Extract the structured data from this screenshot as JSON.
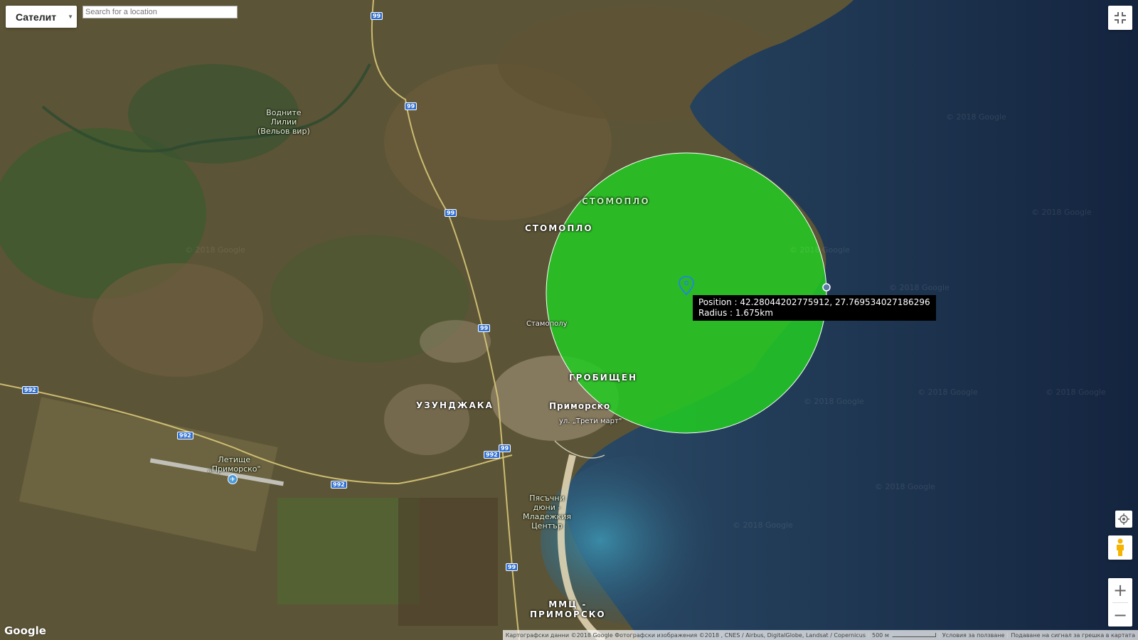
{
  "map_type": {
    "label": "Сателит"
  },
  "search": {
    "placeholder": "Search for a location",
    "value": ""
  },
  "tooltip": {
    "position_line": "Position : 42.28044202775912, 27.769534027186296",
    "radius_line": "Radius : 1.675km"
  },
  "circle": {
    "fill_color": "#22cc22"
  },
  "map_labels": {
    "stomoplo_upper": "СТОМОПЛО",
    "stomoplo": "СТОМОПЛО",
    "stamopolu": "Стамополу",
    "uzundzhaka": "УЗУНДЖАКА",
    "primorsko": "Приморско",
    "grobishten": "ГРОБИЩЕН",
    "treti_mart": "ул. „Трети март\"",
    "vodnite_1": "Водните",
    "vodnite_2": "Лилии",
    "vodnite_3": "(Вельов вир)",
    "airport_1": "Летище",
    "airport_2": "„Приморско\"",
    "dunes_1": "Пясъчни",
    "dunes_2": "дюни -",
    "dunes_3": "Младежкия",
    "dunes_4": "Център",
    "mmc_1": "ММЦ -",
    "mmc_2": "ПРИМОРСКО"
  },
  "road_shields": {
    "r99": "99",
    "r992": "992"
  },
  "watermark": "© 2018 Google",
  "controls": {
    "fullscreen_icon": "fullscreen-exit-icon",
    "locate_icon": "crosshair-icon",
    "pegman_icon": "pegman-icon",
    "zoom_in": "+",
    "zoom_out": "−"
  },
  "footer": {
    "attribution": "Картографски данни ©2018 Google Фотографски изображения ©2018 , CNES / Airbus, DigitalGlobe, Landsat / Copernicus",
    "scale": "500 м",
    "terms": "Условия за ползване",
    "report": "Подаване на сигнал за грешка в картата"
  },
  "logo": "Google"
}
